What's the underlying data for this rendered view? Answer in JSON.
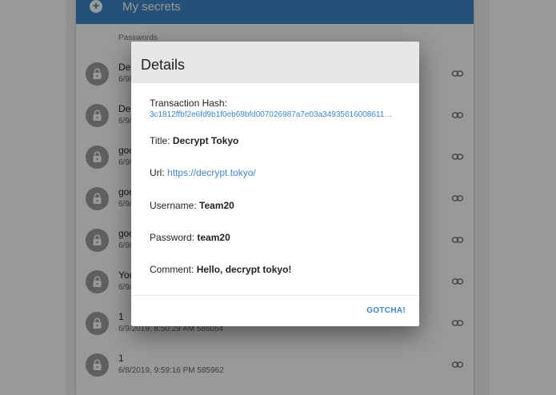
{
  "header": {
    "title": "My secrets",
    "add_icon": "plus-icon"
  },
  "section_label": "Passwords",
  "list": [
    {
      "primary": "Decrypt Tokyo",
      "secondary": "6/9/2019"
    },
    {
      "primary": "Decrypt",
      "secondary": "6/9/2019"
    },
    {
      "primary": "google",
      "secondary": "6/9/2019"
    },
    {
      "primary": "google",
      "secondary": "6/9/2019"
    },
    {
      "primary": "google",
      "secondary": "6/9/2019"
    },
    {
      "primary": "You",
      "secondary": "6/9/2019"
    },
    {
      "primary": "1",
      "secondary": "6/9/2019, 8:50:29 AM 586054"
    },
    {
      "primary": "1",
      "secondary": "6/8/2019, 9:59:16 PM 585962"
    }
  ],
  "dialog": {
    "title": "Details",
    "hash_label": "Transaction Hash:",
    "hash_value": "3c1812ffbf2e6fd9b1f0eb69bfd007026987a7e03a34935616008611…",
    "title_label": "Title:",
    "title_value": "Decrypt Tokyo",
    "url_label": "Url:",
    "url_value": "https://decrypt.tokyo/",
    "username_label": "Username:",
    "username_value": "Team20",
    "password_label": "Password:",
    "password_value": "team20",
    "comment_label": "Comment:",
    "comment_value": "Hello, decrypt tokyo!",
    "confirm_label": "GOTCHA!"
  },
  "colors": {
    "accent": "#3f87c9",
    "avatar": "#9e9e9e"
  }
}
